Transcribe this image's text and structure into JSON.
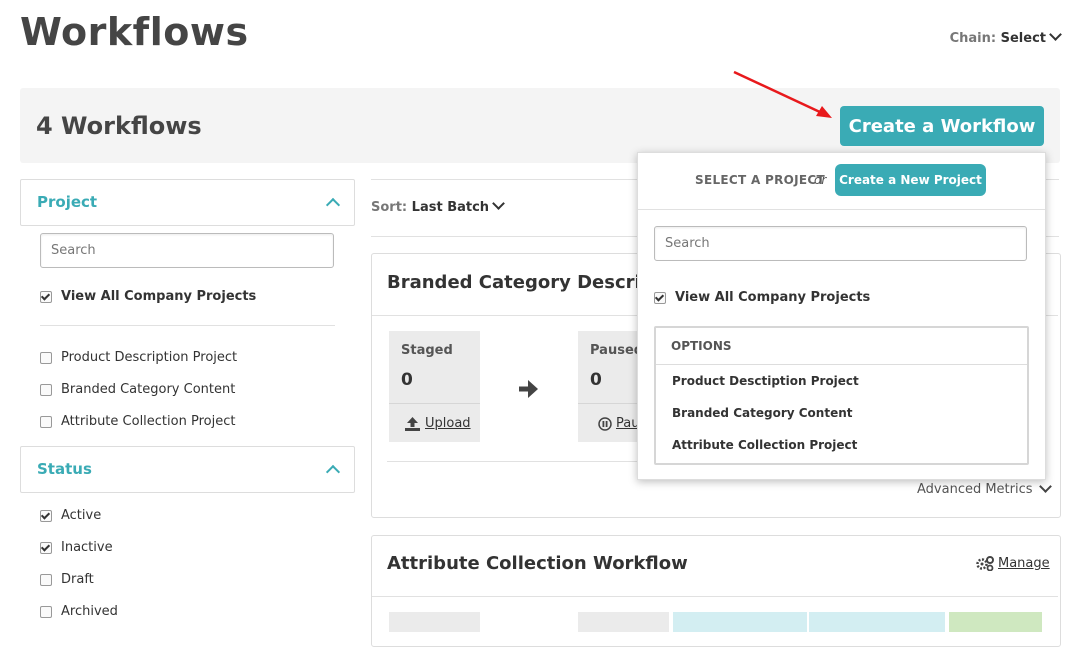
{
  "page": {
    "title": "Workflows"
  },
  "chain": {
    "label": "Chain:",
    "value": "Select"
  },
  "header": {
    "count": "4 Workflows",
    "create_button": "Create a Workflow"
  },
  "sort": {
    "label": "Sort:",
    "value": "Last Batch"
  },
  "project_filter": {
    "title": "Project",
    "search_placeholder": "Search",
    "view_all": "View All Company Projects",
    "items": [
      "Product Description Project",
      "Branded Category Content",
      "Attribute Collection Project"
    ]
  },
  "status_filter": {
    "title": "Status",
    "items": [
      {
        "label": "Active",
        "checked": true
      },
      {
        "label": "Inactive",
        "checked": true
      },
      {
        "label": "Draft",
        "checked": false
      },
      {
        "label": "Archived",
        "checked": false
      }
    ]
  },
  "cards": [
    {
      "title": "Branded Category Descript",
      "stages": [
        {
          "label": "Staged",
          "value": "0",
          "action": "Upload"
        },
        {
          "label": "Paused",
          "value": "0",
          "action": "Pau"
        }
      ],
      "advanced_metrics": "Advanced Metrics"
    },
    {
      "title": "Attribute Collection Workflow",
      "manage": "Manage"
    }
  ],
  "dropdown": {
    "select_label": "SELECT A PROJECT",
    "or": "or",
    "new_project_button": "Create a New Project",
    "search_placeholder": "Search",
    "view_all": "View All Company Projects",
    "options_title": "OPTIONS",
    "options": [
      "Product Desctiption Project",
      "Branded Category Content",
      "Attribute Collection Project"
    ]
  },
  "colors": {
    "accent": "#3aabb5",
    "annotation_arrow": "#e8191c"
  }
}
